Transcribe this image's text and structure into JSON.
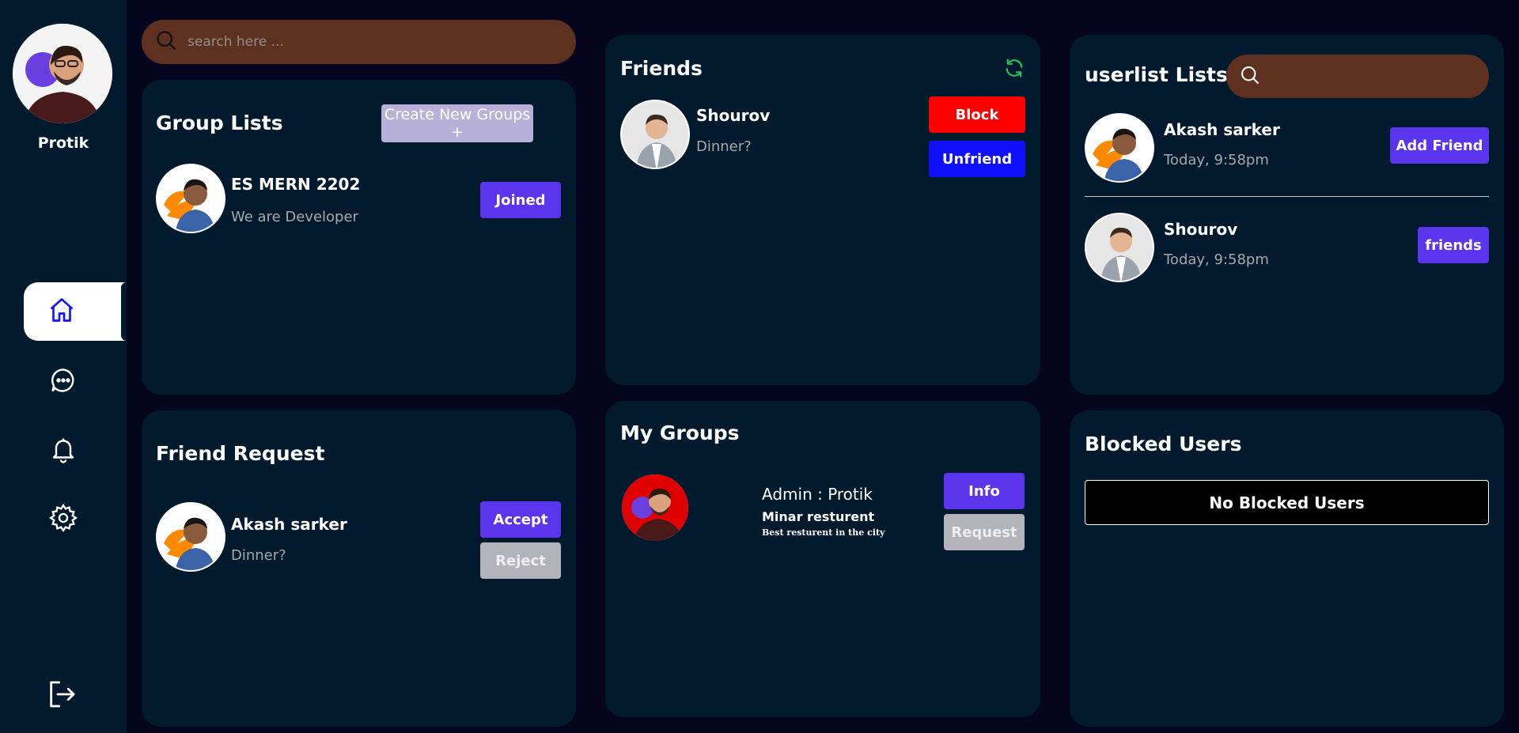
{
  "sidebar": {
    "profile_name": "Protik",
    "nav": [
      {
        "icon": "home-icon",
        "active": true
      },
      {
        "icon": "chat-icon",
        "active": false
      },
      {
        "icon": "bell-icon",
        "active": false
      },
      {
        "icon": "gear-icon",
        "active": false
      }
    ],
    "logout_icon": "logout-icon"
  },
  "search": {
    "placeholder": "search here ..."
  },
  "group_lists": {
    "title": "Group Lists",
    "create_label": "Create New Groups +",
    "items": [
      {
        "name": "ES MERN 2202",
        "sub": "We are Developer",
        "action": "Joined"
      }
    ]
  },
  "friends": {
    "title": "Friends",
    "refresh_icon": "refresh-icon",
    "items": [
      {
        "name": "Shourov",
        "sub": "Dinner?",
        "block": "Block",
        "unfriend": "Unfriend"
      }
    ]
  },
  "userlist": {
    "title": "userlist Lists",
    "items": [
      {
        "name": "Akash sarker",
        "sub": "Today, 9:58pm",
        "action": "Add Friend"
      },
      {
        "name": "Shourov",
        "sub": "Today, 9:58pm",
        "action": "friends"
      }
    ]
  },
  "friend_request": {
    "title": "Friend Request",
    "items": [
      {
        "name": "Akash sarker",
        "sub": "Dinner?",
        "accept": "Accept",
        "reject": "Reject"
      }
    ]
  },
  "my_groups": {
    "title": "My Groups",
    "items": [
      {
        "admin": "Admin : Protik",
        "name": "Minar resturent",
        "tagline": "Best resturent in the city",
        "info": "Info",
        "request": "Request"
      }
    ]
  },
  "blocked": {
    "title": "Blocked Users",
    "empty_text": "No Blocked Users"
  },
  "colors": {
    "background": "#05051f",
    "card": "#021a2e",
    "accent": "#5b35ee",
    "search": "#5e301f",
    "danger": "#ff0000",
    "unfriend": "#1010ff",
    "refresh": "#22c55e"
  }
}
